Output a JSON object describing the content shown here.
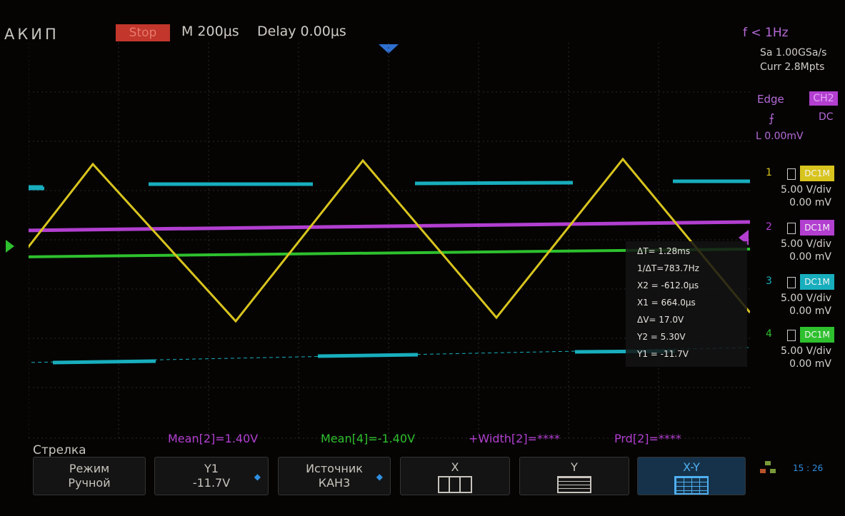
{
  "brand": "АКИП",
  "header": {
    "run_state": "Stop",
    "timebase": "M 200μs",
    "delay": "Delay 0.00μs",
    "freq": "f < 1Hz"
  },
  "acquisition": {
    "sample_rate": "Sa 1.00GSa/s",
    "memory": "Curr 2.8Mpts"
  },
  "trigger": {
    "type": "Edge",
    "source": "CH2",
    "slope_icon": "rising-edge-icon",
    "coupling": "DC",
    "level": "L  0.00mV"
  },
  "channels": [
    {
      "num": "1",
      "coupling": "DC1M",
      "scale": "5.00 V/div",
      "offset": "0.00 mV",
      "color": "#d8c41e"
    },
    {
      "num": "2",
      "coupling": "DC1M",
      "scale": "5.00 V/div",
      "offset": "0.00 mV",
      "color": "#b23fd0"
    },
    {
      "num": "3",
      "coupling": "DC1M",
      "scale": "5.00 V/div",
      "offset": "0.00 mV",
      "color": "#18aebd"
    },
    {
      "num": "4",
      "coupling": "DC1M",
      "scale": "5.00 V/div",
      "offset": "0.00 mV",
      "color": "#2ec02e"
    }
  ],
  "cursor_readout": [
    "ΔT= 1.28ms",
    "1/ΔT=783.7Hz",
    "X2 = -612.0μs",
    "X1 = 664.0μs",
    "ΔV= 17.0V",
    "Y2 = 5.30V",
    "Y1 = -11.7V"
  ],
  "measurements": [
    "Mean[2]=1.40V",
    "Mean[4]=-1.40V",
    "+Width[2]=****",
    "Prd[2]=****"
  ],
  "menu": {
    "title": "Стрелка",
    "mode": {
      "l1": "Режим",
      "l2": "Ручной"
    },
    "y1": {
      "l1": "Y1",
      "l2": "-11.7V"
    },
    "source": {
      "l1": "Источник",
      "l2": "КАН3"
    },
    "x": "X",
    "y": "Y",
    "xy": "X-Y"
  },
  "clock": "15 : 26",
  "colors": {
    "ch1": "#d8c41e",
    "ch2": "#b23fd0",
    "ch3": "#18aebd",
    "ch4": "#2ec02e",
    "stop": "#c2362c"
  }
}
